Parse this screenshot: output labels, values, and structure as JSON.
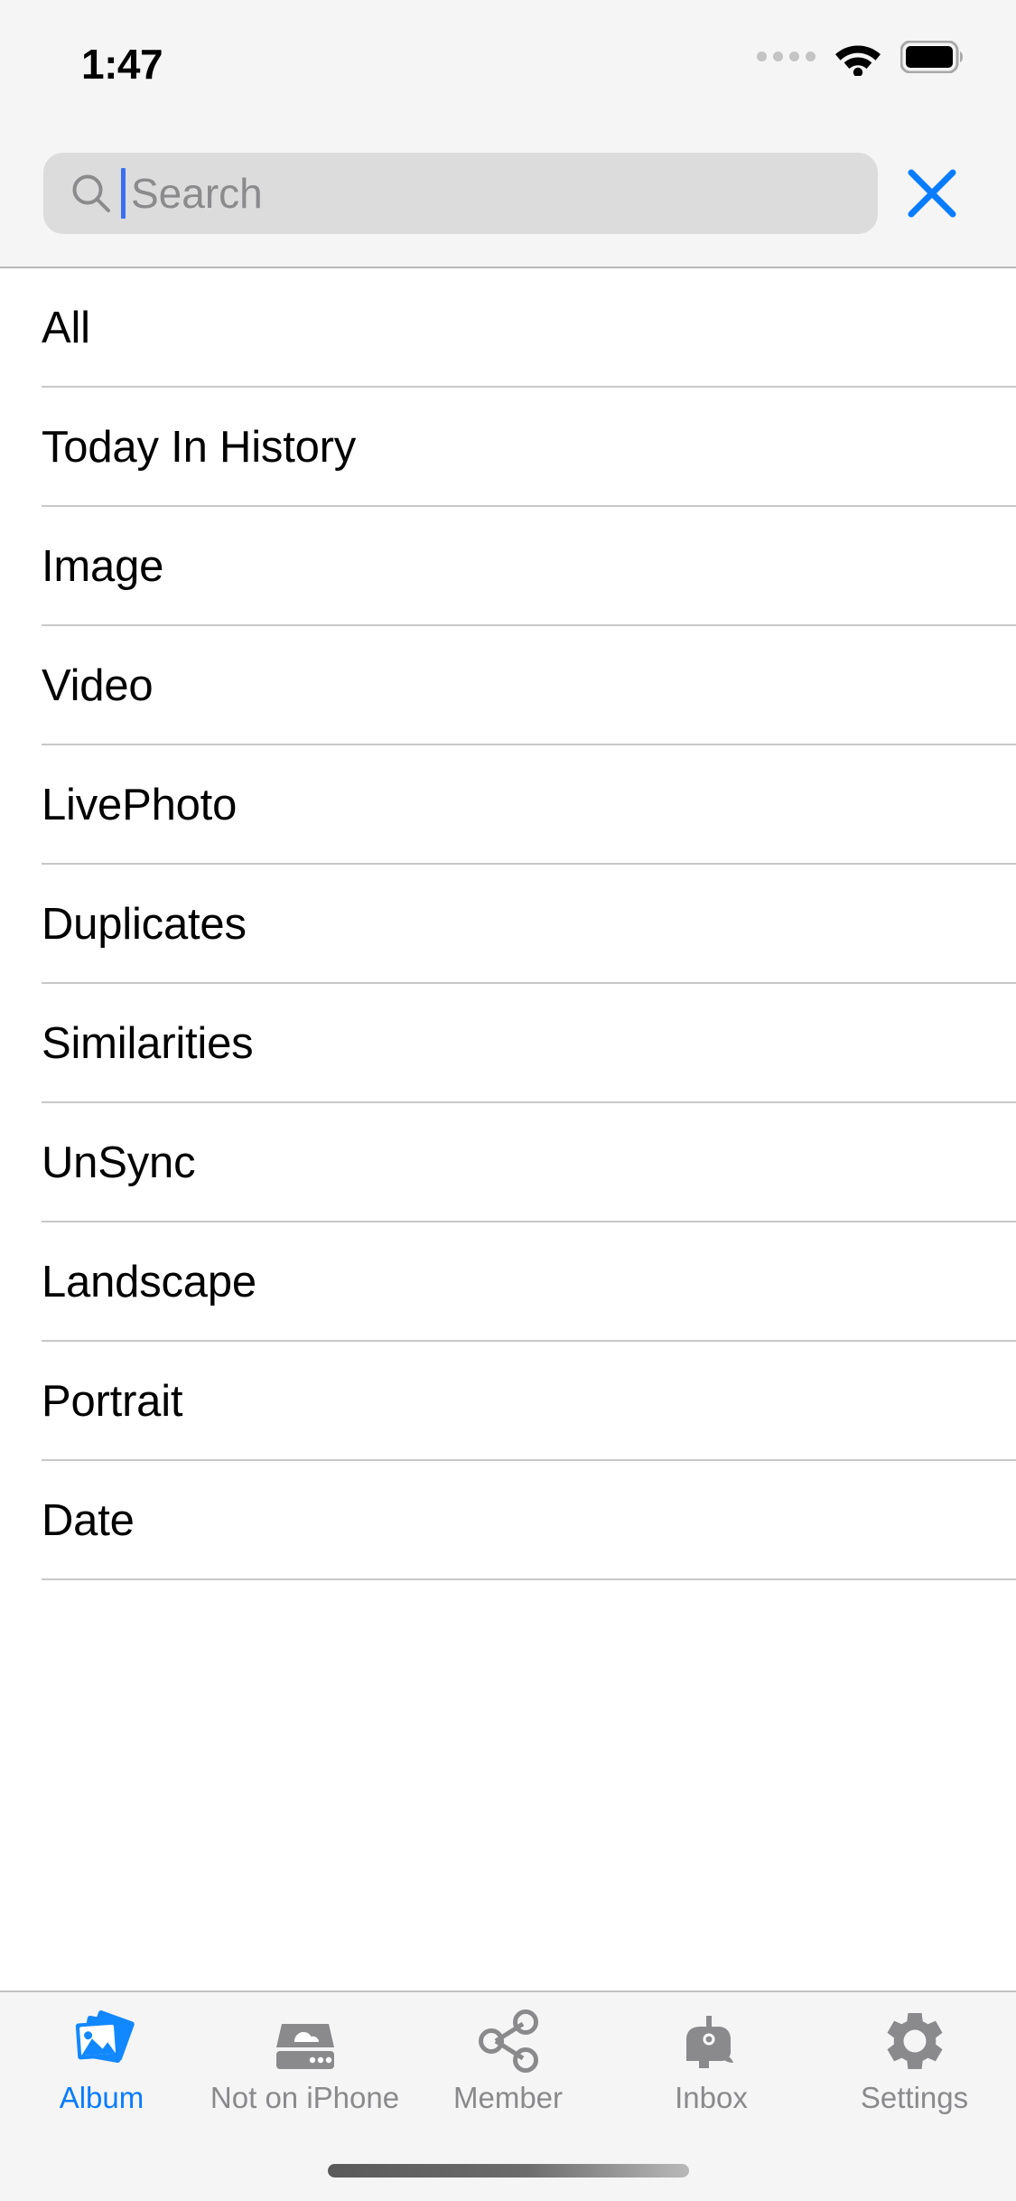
{
  "status_bar": {
    "time": "1:47",
    "signal_dots": 4,
    "wifi_icon": "wifi-icon",
    "battery_icon": "battery-full-icon",
    "battery_level_percent": 100
  },
  "search": {
    "placeholder": "Search",
    "value": "",
    "icon": "search-icon",
    "cursor_visible": true,
    "close_icon": "close-x-icon",
    "close_color": "#0a7cff"
  },
  "list": {
    "items": [
      {
        "label": "All"
      },
      {
        "label": "Today In History"
      },
      {
        "label": "Image"
      },
      {
        "label": "Video"
      },
      {
        "label": "LivePhoto"
      },
      {
        "label": "Duplicates"
      },
      {
        "label": "Similarities"
      },
      {
        "label": "UnSync"
      },
      {
        "label": "Landscape"
      },
      {
        "label": "Portrait"
      },
      {
        "label": "Date"
      }
    ]
  },
  "tab_bar": {
    "active_color": "#0a7cff",
    "inactive_color": "#8a8a8d",
    "items": [
      {
        "label": "Album",
        "icon": "photo-stack-icon",
        "active": true
      },
      {
        "label": "Not on iPhone",
        "icon": "cloud-drive-icon",
        "active": false
      },
      {
        "label": "Member",
        "icon": "share-network-icon",
        "active": false
      },
      {
        "label": "Inbox",
        "icon": "mailbox-icon",
        "active": false
      },
      {
        "label": "Settings",
        "icon": "gear-icon",
        "active": false
      }
    ]
  },
  "home_indicator": {
    "visible": true
  }
}
